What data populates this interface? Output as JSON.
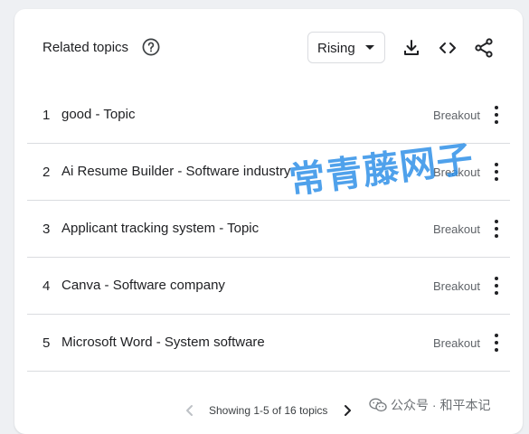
{
  "header": {
    "title": "Related topics",
    "help_icon": "help-circle-icon",
    "select": {
      "value": "Rising",
      "icon": "caret-down-icon"
    },
    "tools": [
      "download-icon",
      "embed-code-icon",
      "share-icon"
    ]
  },
  "rows": [
    {
      "rank": "1",
      "topic": "good - Topic",
      "value": "Breakout"
    },
    {
      "rank": "2",
      "topic": "Ai Resume Builder - Software industry",
      "value": "Breakout"
    },
    {
      "rank": "3",
      "topic": "Applicant tracking system - Topic",
      "value": "Breakout"
    },
    {
      "rank": "4",
      "topic": "Canva - Software company",
      "value": "Breakout"
    },
    {
      "rank": "5",
      "topic": "Microsoft Word - System software",
      "value": "Breakout"
    }
  ],
  "row_menu_icon": "more-vert-icon",
  "pager": {
    "text": "Showing 1-5 of 16 topics",
    "prev_icon": "chevron-left-icon",
    "next_icon": "chevron-right-icon"
  },
  "watermark": {
    "text": "常青藤网子",
    "color": "#288ce6"
  },
  "footer_mark": {
    "icon": "wechat-icon",
    "text": "公众号 · 和平本记"
  },
  "colors": {
    "text_primary": "#202124",
    "text_secondary": "#5f6368",
    "divider": "#dadce0",
    "pager_disabled": "#bdc1c6"
  }
}
